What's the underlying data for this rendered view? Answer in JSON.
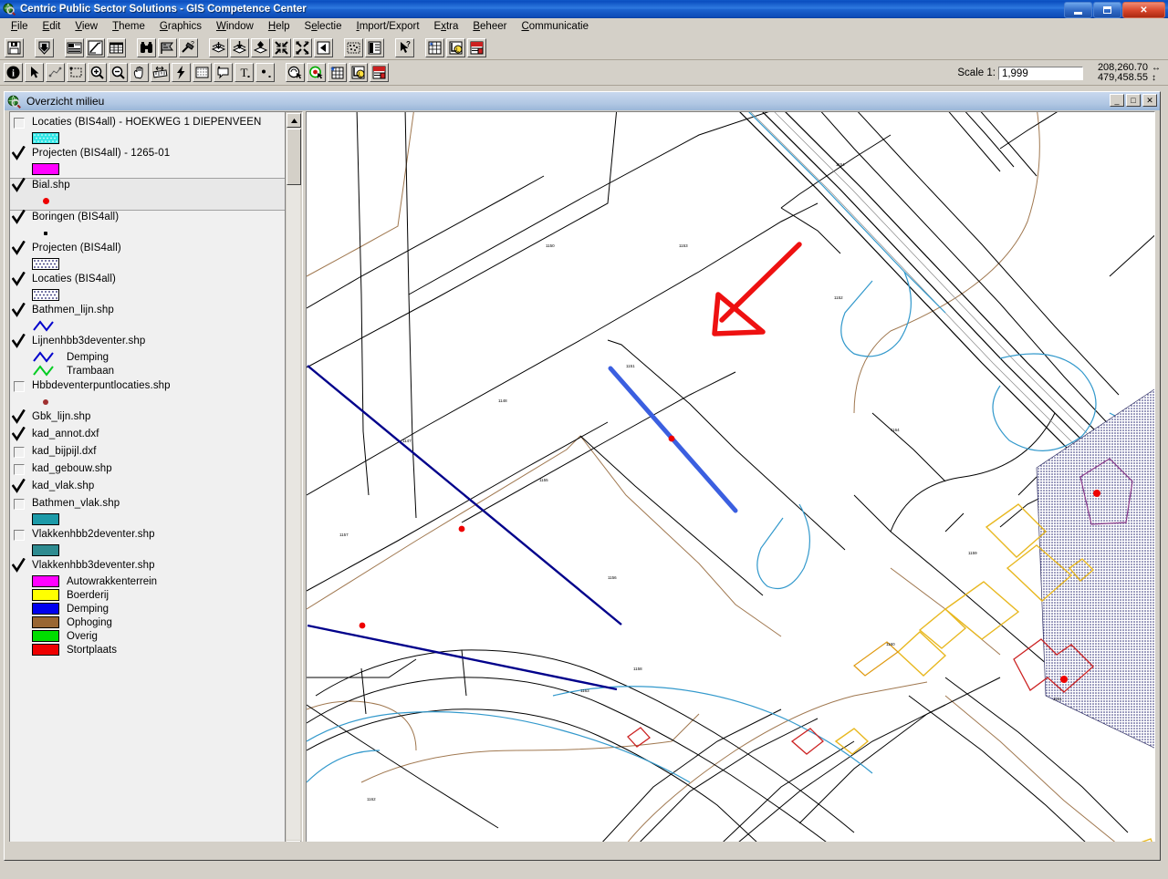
{
  "window": {
    "title": "Centric Public Sector Solutions - GIS Competence Center",
    "app_icon": "globe-magnifier-icon",
    "minimize_label": "",
    "maximize_label": "",
    "close_label": "✕"
  },
  "menubar": {
    "items": [
      {
        "label": "File",
        "name": "menu-file"
      },
      {
        "label": "Edit",
        "name": "menu-edit"
      },
      {
        "label": "View",
        "name": "menu-view"
      },
      {
        "label": "Theme",
        "name": "menu-theme"
      },
      {
        "label": "Graphics",
        "name": "menu-graphics"
      },
      {
        "label": "Window",
        "name": "menu-window"
      },
      {
        "label": "Help",
        "name": "menu-help"
      },
      {
        "label": "Selectie",
        "name": "menu-selectie"
      },
      {
        "label": "Import/Export",
        "name": "menu-import-export"
      },
      {
        "label": "Extra",
        "name": "menu-extra"
      },
      {
        "label": "Beheer",
        "name": "menu-beheer"
      },
      {
        "label": "Communicatie",
        "name": "menu-communicatie"
      }
    ]
  },
  "toolbar_row1": {
    "buttons": [
      {
        "name": "save-project-button",
        "icon": "floppy-disk-icon"
      },
      {
        "gap": true
      },
      {
        "name": "add-theme-button",
        "icon": "down-arrow-shield-icon"
      },
      {
        "gap": true
      },
      {
        "name": "theme-properties-button",
        "icon": "theme-table-icon"
      },
      {
        "name": "edit-legend-button",
        "icon": "pencil-ruler-icon"
      },
      {
        "name": "open-table-button",
        "icon": "grid-table-icon"
      },
      {
        "gap": true
      },
      {
        "name": "find-button",
        "icon": "binoculars-icon"
      },
      {
        "name": "query-builder-button",
        "icon": "flag-query-icon"
      },
      {
        "name": "hammer-tools-button",
        "icon": "hammer-icon"
      },
      {
        "gap": true
      },
      {
        "name": "zoom-to-themes-button",
        "icon": "layers-down-icon"
      },
      {
        "name": "zoom-to-selected-button",
        "icon": "layers-down-alt-icon"
      },
      {
        "name": "zoom-to-active-button",
        "icon": "layers-diamond-icon"
      },
      {
        "name": "zoom-in-fixed-button",
        "icon": "arrows-in-icon"
      },
      {
        "name": "zoom-out-fixed-button",
        "icon": "arrows-out-icon"
      },
      {
        "name": "zoom-previous-button",
        "icon": "back-arrow-icon"
      },
      {
        "gap": true
      },
      {
        "name": "select-features-button",
        "icon": "dotted-select-icon"
      },
      {
        "name": "open-layout-button",
        "icon": "layout-panel-icon"
      },
      {
        "gap": true
      },
      {
        "name": "context-help-button",
        "icon": "arrow-question-icon"
      },
      {
        "gap": true
      },
      {
        "name": "table-blue-button",
        "icon": "table-blue-star-icon"
      },
      {
        "name": "label-yellow-button",
        "icon": "label-yellow-icon"
      },
      {
        "name": "red-document-button",
        "icon": "red-document-icon"
      }
    ]
  },
  "toolbar_row2": {
    "buttons": [
      {
        "name": "identify-tool",
        "icon": "info-circle-icon"
      },
      {
        "name": "pointer-tool",
        "icon": "arrow-pointer-icon"
      },
      {
        "name": "vertex-edit-tool",
        "icon": "vertex-edit-icon"
      },
      {
        "name": "select-box-tool",
        "icon": "dashed-box-icon"
      },
      {
        "name": "zoom-in-tool",
        "icon": "magnifier-plus-icon"
      },
      {
        "name": "zoom-out-tool",
        "icon": "magnifier-minus-icon"
      },
      {
        "name": "pan-tool",
        "icon": "hand-icon"
      },
      {
        "name": "measure-tool",
        "icon": "ruler-icon"
      },
      {
        "name": "hot-link-tool",
        "icon": "lightning-icon"
      },
      {
        "name": "area-select-tool",
        "icon": "dotted-area-icon"
      },
      {
        "name": "callout-tool",
        "icon": "callout-icon"
      },
      {
        "name": "text-tool",
        "icon": "text-t-icon"
      },
      {
        "name": "draw-point-tool",
        "icon": "point-draw-icon"
      },
      {
        "gap": true
      },
      {
        "name": "select-query-tool",
        "icon": "select-arrow-circle-icon"
      },
      {
        "name": "identify-green-tool",
        "icon": "green-circle-icon"
      },
      {
        "name": "grid-blue-tool",
        "icon": "blue-star-grid-icon"
      },
      {
        "name": "label-yellow-tool",
        "icon": "label-yellow-icon"
      },
      {
        "name": "red-document-tool",
        "icon": "red-document-icon"
      }
    ]
  },
  "scale": {
    "label": "Scale 1:",
    "value": "1,999",
    "coord_x": "208,260.70",
    "coord_y": "479,458.55",
    "x_arrow": "↔",
    "y_arrow": "↕"
  },
  "document": {
    "title": "Overzicht milieu",
    "icon": "globe-magnifier-icon",
    "minimize_label": "_",
    "maximize_label": "□",
    "close_label": "✕"
  },
  "toc": {
    "scroll_up_label": "▲",
    "scroll_down_label": "▼",
    "layers": [
      {
        "name": "Locaties (BIS4all) -  HOEKWEG 1 DIEPENVEEN",
        "checked": false,
        "selected": false,
        "symbols": [
          {
            "type": "fill",
            "color": "#33e6e6",
            "pattern": "dots",
            "label": ""
          }
        ]
      },
      {
        "name": "Projecten (BIS4all) -  1265-01",
        "checked": true,
        "selected": false,
        "symbols": [
          {
            "type": "fill",
            "color": "#ff00ff",
            "pattern": "solid",
            "label": ""
          }
        ]
      },
      {
        "name": "Bial.shp",
        "checked": true,
        "selected": true,
        "symbols": [
          {
            "type": "point",
            "color": "#ee0000",
            "size": 7,
            "label": ""
          }
        ]
      },
      {
        "name": "Boringen (BIS4all)",
        "checked": true,
        "selected": false,
        "symbols": [
          {
            "type": "point",
            "color": "#000000",
            "size": 4,
            "label": ""
          }
        ]
      },
      {
        "name": "Projecten (BIS4all)",
        "checked": true,
        "selected": false,
        "symbols": [
          {
            "type": "fill",
            "color": "#ffffff",
            "pattern": "dots-dark",
            "label": ""
          }
        ]
      },
      {
        "name": "Locaties (BIS4all)",
        "checked": true,
        "selected": false,
        "symbols": [
          {
            "type": "fill",
            "color": "#ffffff",
            "pattern": "dots-dark",
            "label": ""
          }
        ]
      },
      {
        "name": "Bathmen_lijn.shp",
        "checked": true,
        "selected": false,
        "symbols": [
          {
            "type": "line",
            "color": "#0000cc",
            "label": ""
          }
        ]
      },
      {
        "name": "Lijnenhbb3deventer.shp",
        "checked": true,
        "selected": false,
        "symbols": [
          {
            "type": "line",
            "color": "#0000cc",
            "label": "Demping"
          },
          {
            "type": "line",
            "color": "#00cc22",
            "label": "Trambaan"
          }
        ]
      },
      {
        "name": "Hbbdeventerpuntlocaties.shp",
        "checked": false,
        "selected": false,
        "symbols": [
          {
            "type": "point",
            "color": "#a03030",
            "size": 6,
            "label": ""
          }
        ]
      },
      {
        "name": "Gbk_lijn.shp",
        "checked": true,
        "selected": false,
        "symbols": []
      },
      {
        "name": "kad_annot.dxf",
        "checked": true,
        "selected": false,
        "symbols": []
      },
      {
        "name": "kad_bijpijl.dxf",
        "checked": false,
        "selected": false,
        "symbols": []
      },
      {
        "name": "kad_gebouw.shp",
        "checked": false,
        "selected": false,
        "symbols": []
      },
      {
        "name": "kad_vlak.shp",
        "checked": true,
        "selected": false,
        "symbols": []
      },
      {
        "name": "Bathmen_vlak.shp",
        "checked": false,
        "selected": false,
        "symbols": [
          {
            "type": "fill",
            "color": "#1c9aa8",
            "pattern": "solid",
            "label": ""
          }
        ]
      },
      {
        "name": "Vlakkenhbb2deventer.shp",
        "checked": false,
        "selected": false,
        "symbols": [
          {
            "type": "fill",
            "color": "#2e8b90",
            "pattern": "solid",
            "label": ""
          }
        ]
      },
      {
        "name": "Vlakkenhbb3deventer.shp",
        "checked": true,
        "selected": false,
        "symbols": [
          {
            "type": "fill",
            "color": "#ff00ff",
            "pattern": "solid",
            "label": "Autowrakkenterrein"
          },
          {
            "type": "fill",
            "color": "#ffff00",
            "pattern": "solid",
            "label": "Boerderij"
          },
          {
            "type": "fill",
            "color": "#0000ee",
            "pattern": "solid",
            "label": "Demping"
          },
          {
            "type": "fill",
            "color": "#996633",
            "pattern": "solid",
            "label": "Ophoging"
          },
          {
            "type": "fill",
            "color": "#00dd00",
            "pattern": "solid",
            "label": "Overig"
          },
          {
            "type": "fill",
            "color": "#ee0000",
            "pattern": "solid",
            "label": "Stortplaats"
          }
        ]
      }
    ]
  },
  "map": {
    "name": "map-canvas",
    "background": "#ffffff",
    "annotation": {
      "type": "red-arrow",
      "color": "#ee1111"
    },
    "parcel_labels": [
      "1145",
      "1146",
      "1147",
      "1148",
      "1149",
      "1150",
      "1151",
      "1152",
      "1153",
      "1154",
      "1155",
      "1156",
      "1157"
    ],
    "colors": {
      "parcel_line": "#000000",
      "contour_line": "#a07850",
      "water_line": "#3399cc",
      "highlight_line": "#3355dd",
      "dark_blue_line": "#000088",
      "building_yellow": "#e8b820",
      "building_red": "#cc2222",
      "selection_dot": "#ee0000",
      "project_fill": "#8a3a8a"
    }
  }
}
